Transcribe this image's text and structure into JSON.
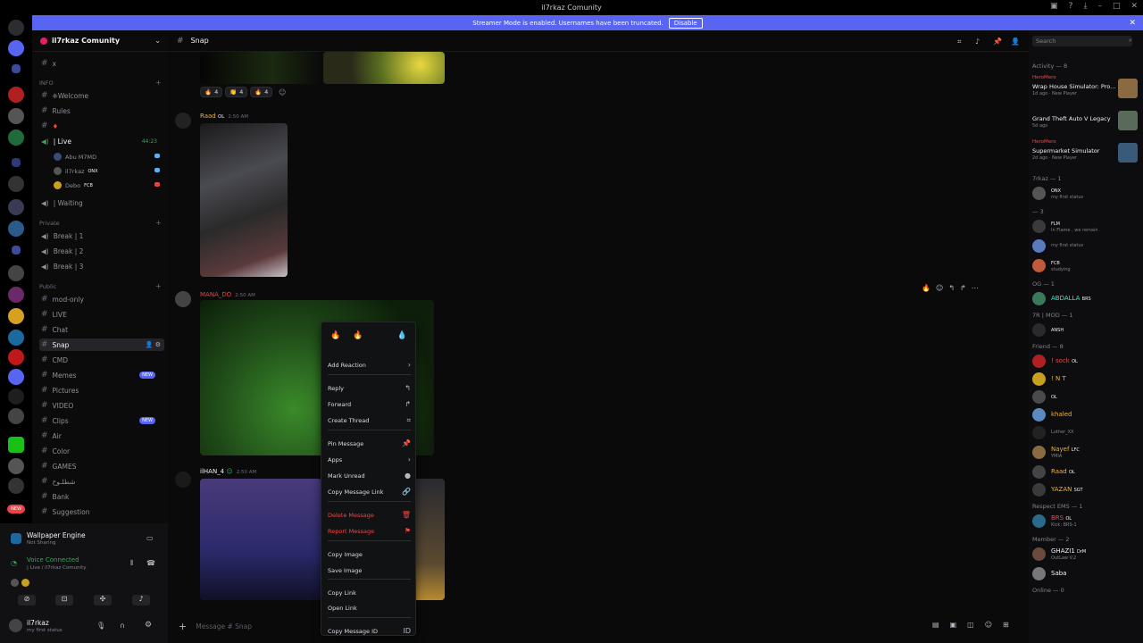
{
  "window": {
    "title": "il7rkaz Comunity"
  },
  "banner": {
    "text": "Streamer Mode is enabled. Usernames have been truncated.",
    "button": "Disable"
  },
  "server": {
    "name": "il7rkaz Comunity"
  },
  "channels": {
    "top": [
      {
        "label": "x"
      }
    ],
    "info_cat": "INFO",
    "info": [
      {
        "label": "❈Welcome"
      },
      {
        "label": "Rules"
      },
      {
        "label": ""
      }
    ],
    "live_voice": {
      "label": "| Live",
      "count": "44:23"
    },
    "live_users": [
      {
        "name": "Abu M7MD",
        "tag": ""
      },
      {
        "name": "il7rkaz",
        "tag": "ONX"
      },
      {
        "name": "Debo",
        "tag": "FCB"
      }
    ],
    "waiting": "| Waiting",
    "private_cat": "Private",
    "private": [
      {
        "label": "Break | 1"
      },
      {
        "label": "Break | 2"
      },
      {
        "label": "Break | 3"
      }
    ],
    "public_cat": "Public",
    "public": [
      {
        "label": "mod-only",
        "sel": false,
        "new": false
      },
      {
        "label": "LIVE",
        "sel": false,
        "new": false
      },
      {
        "label": "Chat",
        "sel": false,
        "new": false
      },
      {
        "label": "Snap",
        "sel": true,
        "new": false
      },
      {
        "label": "CMD",
        "sel": false,
        "new": false
      },
      {
        "label": "Memes",
        "sel": false,
        "new": true
      },
      {
        "label": "Pictures",
        "sel": false,
        "new": false
      },
      {
        "label": "VIDEO",
        "sel": false,
        "new": false
      },
      {
        "label": "Clips",
        "sel": false,
        "new": true
      },
      {
        "label": "Air",
        "sel": false,
        "new": false
      },
      {
        "label": "Color",
        "sel": false,
        "new": false
      },
      {
        "label": "GAMES",
        "sel": false,
        "new": false
      },
      {
        "label": "شطلـوح",
        "sel": false,
        "new": false
      },
      {
        "label": "Bank",
        "sel": false,
        "new": false
      },
      {
        "label": "Suggestion",
        "sel": false,
        "new": false
      }
    ],
    "new_badge": "NEW"
  },
  "activity_panel": {
    "title": "Wallpaper Engine",
    "sub": "Not Sharing"
  },
  "voice": {
    "status": "Voice Connected",
    "where": "| Live / il7rkaz Comunity"
  },
  "user": {
    "name": "il7rkaz",
    "status": "my first status"
  },
  "header": {
    "channel": "Snap",
    "search_placeholder": "Search"
  },
  "messages": [
    {
      "author": "Raad",
      "tag": "OL",
      "time": "2:50 AM"
    },
    {
      "author": "MANA_DO",
      "tag": "",
      "time": "2:50 AM"
    },
    {
      "author": "ilHAN_4",
      "tag": "",
      "time": "2:50 AM"
    }
  ],
  "reactions": [
    {
      "emoji": "🔥",
      "count": "4"
    },
    {
      "emoji": "👏",
      "count": "4"
    },
    {
      "emoji": "🔥",
      "count": "4"
    }
  ],
  "composer": {
    "placeholder": "Message #  Snap"
  },
  "context_menu": {
    "quick": [
      "🔥",
      "🔥",
      "",
      "💧"
    ],
    "items": [
      {
        "label": "Add Reaction",
        "icon": "chevron-right"
      },
      {
        "label": "Reply",
        "icon": "reply"
      },
      {
        "label": "Forward",
        "icon": "forward"
      },
      {
        "label": "Create Thread",
        "icon": "thread"
      },
      {
        "label": "Pin Message",
        "icon": "pin"
      },
      {
        "label": "Apps",
        "icon": "chevron-right"
      },
      {
        "label": "Mark Unread",
        "icon": "mark-unread"
      },
      {
        "label": "Copy Message Link",
        "icon": "link"
      },
      {
        "label": "Delete Message",
        "icon": "trash"
      },
      {
        "label": "Report Message",
        "icon": "flag"
      },
      {
        "label": "Copy Image",
        "icon": ""
      },
      {
        "label": "Save Image",
        "icon": ""
      },
      {
        "label": "Copy Link",
        "icon": ""
      },
      {
        "label": "Open Link",
        "icon": ""
      },
      {
        "label": "Copy Message ID",
        "icon": "id"
      }
    ]
  },
  "members": {
    "activity_label": "Activity — 8",
    "activities": [
      {
        "who": "HeroMero",
        "title": "Wrap House Simulator: Pro...",
        "sub": "1d ago  ·  New Player"
      },
      {
        "who": "",
        "title": "Grand Theft Auto V Legacy",
        "sub": "5d ago"
      },
      {
        "who": "HeroMero",
        "title": "Supermarket Simulator",
        "sub": "2d ago  ·  New Player"
      }
    ],
    "groups": [
      {
        "label": "7rkaz — 1",
        "members": [
          {
            "name": "",
            "tag": "ONX",
            "status": "my first status",
            "color": "#f2f3f5"
          }
        ]
      },
      {
        "label": "— 3",
        "members": [
          {
            "name": "",
            "tag": "FLM",
            "status": "In Flame , we remain .",
            "color": "#f04747"
          },
          {
            "name": "",
            "tag": "",
            "status": "my first status",
            "color": "#f04747"
          },
          {
            "name": "",
            "tag": "FCB",
            "status": "studying",
            "color": "#f04747"
          }
        ]
      },
      {
        "label": "OG — 1",
        "members": [
          {
            "name": "ABDALLA",
            "tag": "BRS",
            "status": "",
            "color": "#43e5c0"
          }
        ]
      },
      {
        "label": "7R | MOD — 1",
        "members": [
          {
            "name": "",
            "tag": "ANSH",
            "status": "",
            "color": "#f04747"
          }
        ]
      },
      {
        "label": "Friend — 8",
        "members": [
          {
            "name": "! sock",
            "tag": "OL",
            "status": "",
            "color": "#f04747"
          },
          {
            "name": "! N T",
            "tag": "",
            "status": "",
            "color": "#f0b232"
          },
          {
            "name": "",
            "tag": "OL",
            "status": "",
            "color": "#f04747"
          },
          {
            "name": "khaled",
            "tag": "",
            "status": "",
            "color": "#f0b232"
          },
          {
            "name": "",
            "tag": "",
            "status": "Luther_XX",
            "color": "#80848e"
          },
          {
            "name": "Nayef",
            "tag": "LFC",
            "status": "YMIA",
            "color": "#f0b232"
          },
          {
            "name": "Raad",
            "tag": "OL",
            "status": "",
            "color": "#f0b232"
          },
          {
            "name": "YAZAN",
            "tag": "SGT",
            "status": "",
            "color": "#f0b232"
          }
        ]
      },
      {
        "label": "Respect EMS — 1",
        "members": [
          {
            "name": "BRS",
            "tag": "OL",
            "status": "Kick: BRS-1",
            "color": "#f04747"
          }
        ]
      },
      {
        "label": "Member — 2",
        "members": [
          {
            "name": "GHAZI1",
            "tag": "DrM",
            "status": "OutLaw V.2",
            "color": "#f2f3f5"
          },
          {
            "name": "Saba",
            "tag": "",
            "status": "",
            "color": "#f2f3f5"
          }
        ]
      },
      {
        "label": "Online — 0",
        "members": []
      }
    ]
  }
}
